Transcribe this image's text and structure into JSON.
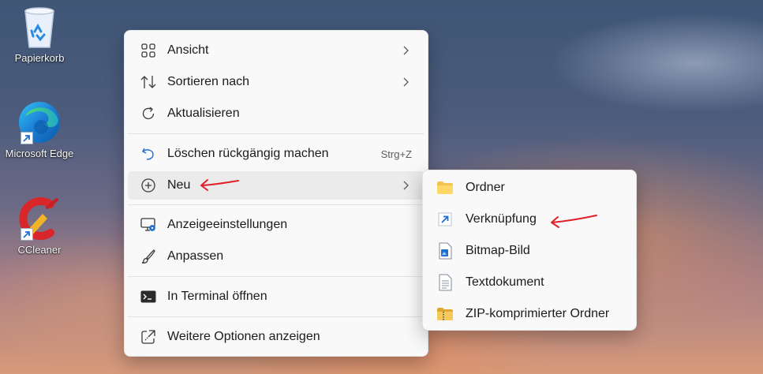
{
  "desktop": {
    "icons": [
      {
        "label": "Papierkorb",
        "icon": "recycle-bin-icon"
      },
      {
        "label": "Microsoft Edge",
        "icon": "edge-icon"
      },
      {
        "label": "CCleaner",
        "icon": "ccleaner-icon"
      }
    ]
  },
  "context_menu": {
    "items": [
      {
        "label": "Ansicht",
        "icon": "grid-view-icon",
        "has_submenu": true
      },
      {
        "label": "Sortieren nach",
        "icon": "sort-icon",
        "has_submenu": true
      },
      {
        "label": "Aktualisieren",
        "icon": "refresh-icon"
      },
      {
        "label": "Löschen rückgängig machen",
        "icon": "undo-icon",
        "shortcut": "Strg+Z"
      },
      {
        "label": "Neu",
        "icon": "plus-circle-icon",
        "has_submenu": true,
        "highlighted": true
      },
      {
        "label": "Anzeigeeinstellungen",
        "icon": "display-settings-icon"
      },
      {
        "label": "Anpassen",
        "icon": "brush-icon"
      },
      {
        "label": "In Terminal öffnen",
        "icon": "terminal-icon"
      },
      {
        "label": "Weitere Optionen anzeigen",
        "icon": "more-options-icon"
      }
    ]
  },
  "new_submenu": {
    "items": [
      {
        "label": "Ordner",
        "icon": "folder-icon"
      },
      {
        "label": "Verknüpfung",
        "icon": "shortcut-icon"
      },
      {
        "label": "Bitmap-Bild",
        "icon": "bitmap-icon"
      },
      {
        "label": "Textdokument",
        "icon": "text-document-icon"
      },
      {
        "label": "ZIP-komprimierter Ordner",
        "icon": "zip-folder-icon"
      }
    ]
  },
  "colors": {
    "annotation_arrow": "#e0202a",
    "menu_background": "#f9f9f9",
    "highlight": "#ebebeb"
  }
}
